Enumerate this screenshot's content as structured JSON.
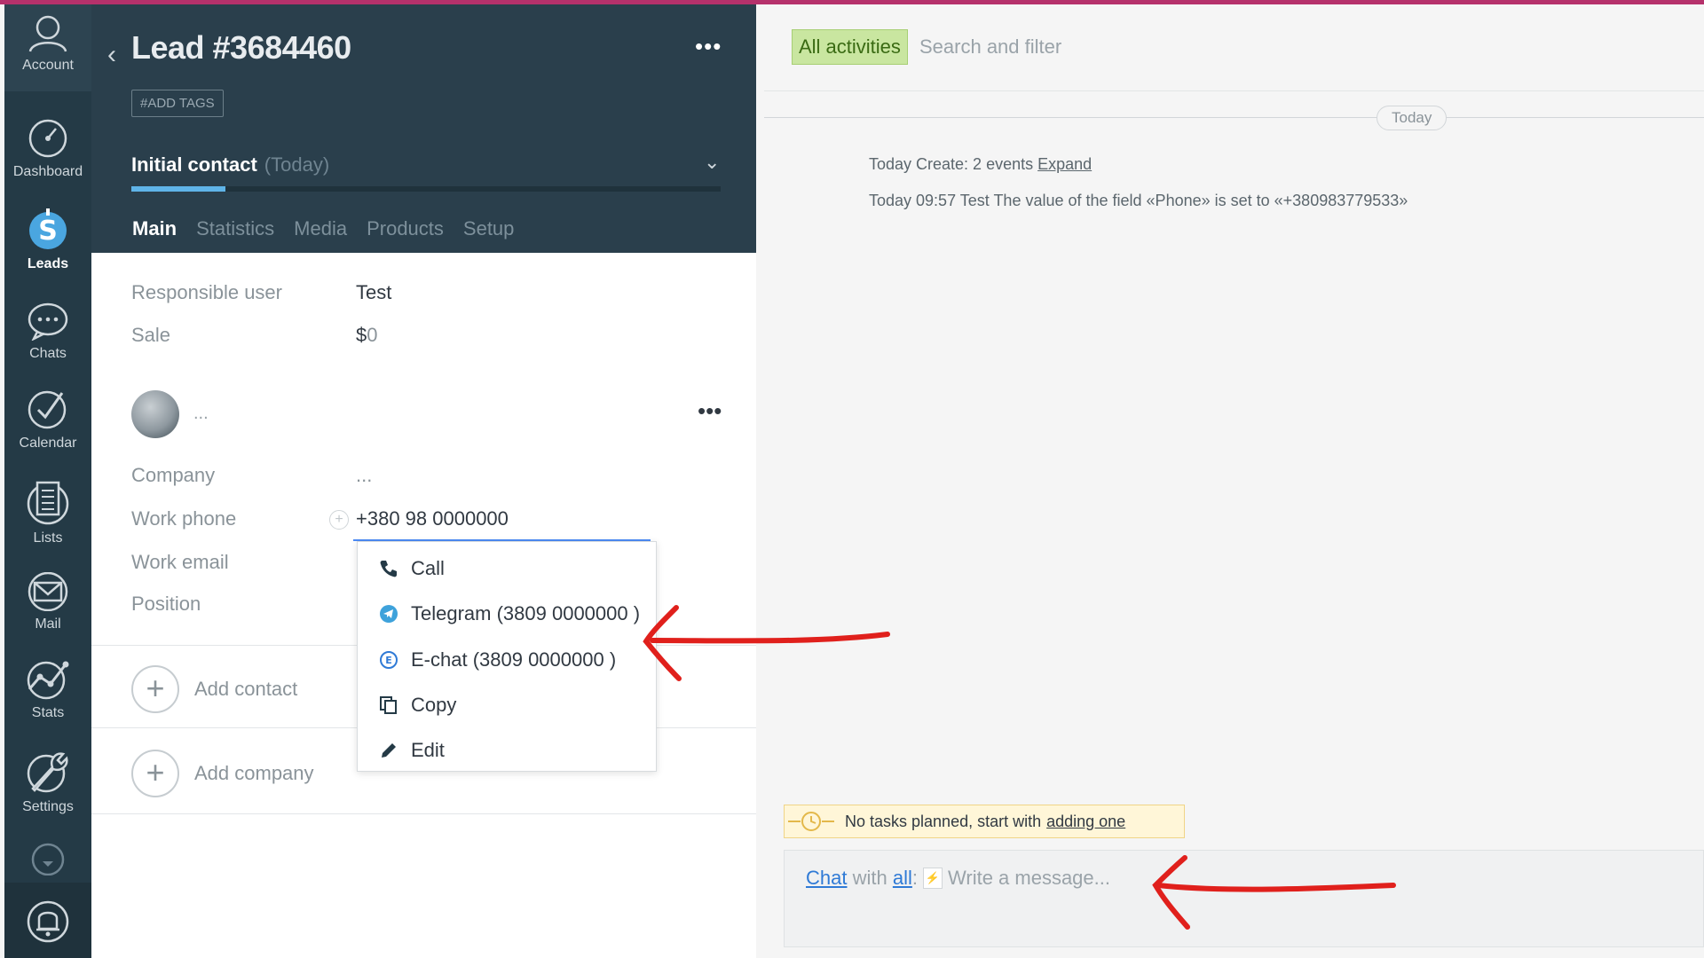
{
  "nav": {
    "account": "Account",
    "items": [
      {
        "label": "Dashboard",
        "icon": "speedometer-icon"
      },
      {
        "label": "Leads",
        "icon": "leads-icon"
      },
      {
        "label": "Chats",
        "icon": "chat-bubble-icon"
      },
      {
        "label": "Calendar",
        "icon": "check-circle-icon"
      },
      {
        "label": "Lists",
        "icon": "list-icon"
      },
      {
        "label": "Mail",
        "icon": "mail-icon"
      },
      {
        "label": "Stats",
        "icon": "stats-icon"
      },
      {
        "label": "Settings",
        "icon": "wrench-icon"
      }
    ]
  },
  "lead": {
    "title": "Lead #3684460",
    "tags_button": "#ADD TAGS",
    "status": "Initial contact",
    "status_date": "(Today)",
    "stage_progress": 0.16,
    "tabs": [
      "Main",
      "Statistics",
      "Media",
      "Products",
      "Setup"
    ]
  },
  "fields": {
    "responsible_label": "Responsible user",
    "responsible_value": "Test",
    "sale_label": "Sale",
    "sale_currency": "$",
    "sale_value": "0",
    "contact_name": "...",
    "company_label": "Company",
    "company_value": "...",
    "work_phone_label": "Work phone",
    "work_phone_value": "+380 98 0000000",
    "work_email_label": "Work email",
    "position_label": "Position"
  },
  "actions": {
    "add_contact": "Add contact",
    "add_company": "Add company"
  },
  "phone_menu": {
    "items": [
      {
        "label": "Call",
        "icon": "phone-icon"
      },
      {
        "label": "Telegram (3809 0000000 )",
        "icon": "telegram-icon"
      },
      {
        "label": "E-chat (3809 0000000 )",
        "icon": "echat-icon"
      },
      {
        "label": "Copy",
        "icon": "copy-icon"
      },
      {
        "label": "Edit",
        "icon": "pencil-icon"
      }
    ]
  },
  "feed": {
    "filter_button": "All activities",
    "search_placeholder": "Search and filter",
    "day_label": "Today",
    "events": [
      {
        "text": "Today Create: 2 events ",
        "link": "Expand"
      },
      {
        "text": "Today 09:57 Test The value of the field «Phone» is set to «+380983779533»",
        "link": ""
      }
    ],
    "tasks_text": "No tasks planned, start with",
    "tasks_link": "adding one",
    "composer_chat": "Chat",
    "composer_with": "with",
    "composer_all": "all",
    "composer_placeholder": "Write a message..."
  },
  "colors": {
    "sidebar": "#243a46",
    "lead_header": "#2a3f4c",
    "accent_blue": "#5fb4e8",
    "annotation_red": "#e0201c",
    "filter_green": "#c9e6a0"
  }
}
